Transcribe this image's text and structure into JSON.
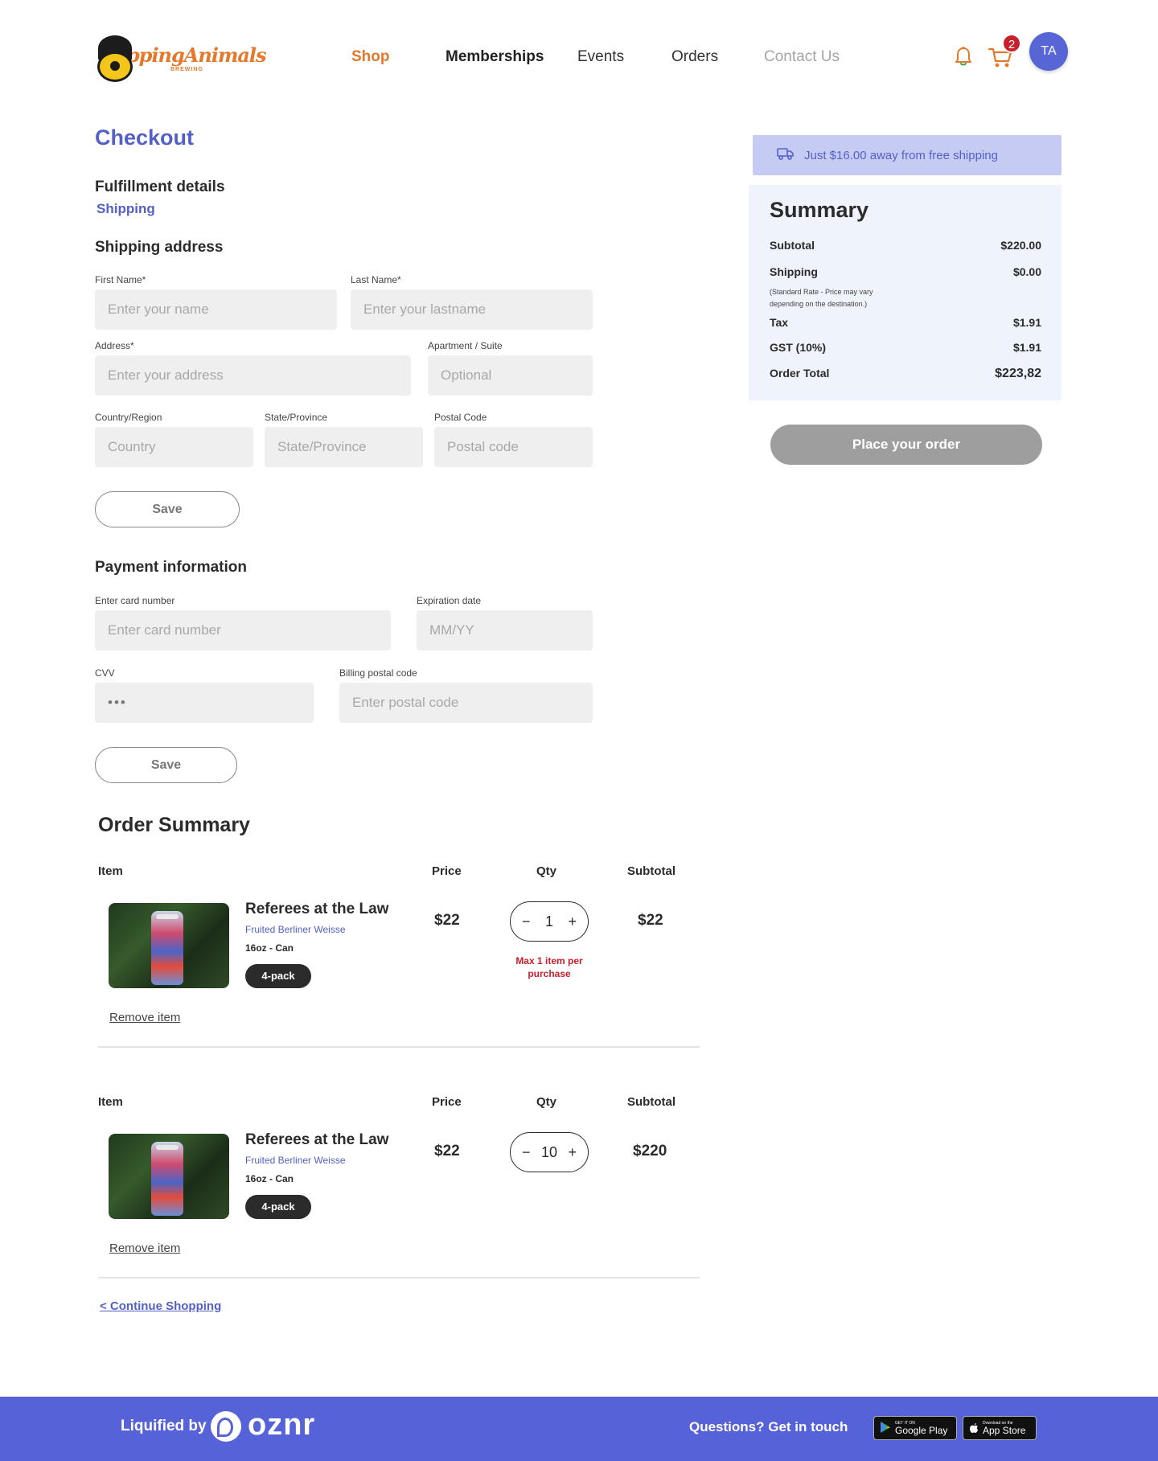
{
  "brand": {
    "logo_text": "TrippingAnimals",
    "logo_sub": "BREWING"
  },
  "nav": {
    "shop": "Shop",
    "memberships": "Memberships",
    "events": "Events",
    "orders": "Orders",
    "contact": "Contact Us"
  },
  "header": {
    "cart_count": "2",
    "avatar_initials": "TA"
  },
  "checkout": {
    "title": "Checkout",
    "fulfillment_heading": "Fulfillment details",
    "fulfillment_method": "Shipping",
    "shipping_heading": "Shipping address",
    "fields": {
      "first_name": {
        "label": "First Name*",
        "placeholder": "Enter your name"
      },
      "last_name": {
        "label": "Last Name*",
        "placeholder": "Enter your lastname"
      },
      "address": {
        "label": "Address*",
        "placeholder": "Enter your address"
      },
      "apartment": {
        "label": "Apartment / Suite",
        "placeholder": "Optional"
      },
      "country": {
        "label": "Country/Region",
        "placeholder": "Country"
      },
      "state": {
        "label": "State/Province",
        "placeholder": "State/Province"
      },
      "postal": {
        "label": "Postal Code",
        "placeholder": "Postal code"
      }
    },
    "save_label": "Save",
    "payment_heading": "Payment information",
    "payment_fields": {
      "card": {
        "label": "Enter card number",
        "placeholder": "Enter card number"
      },
      "expiry": {
        "label": "Expiration date",
        "placeholder": "MM/YY"
      },
      "cvv": {
        "label": "CVV",
        "value": "•••"
      },
      "billing_postal": {
        "label": "Billing postal code",
        "placeholder": "Enter postal code"
      }
    },
    "payment_save_label": "Save"
  },
  "order_summary": {
    "title": "Order Summary",
    "columns": {
      "item": "Item",
      "price": "Price",
      "qty": "Qty",
      "subtotal": "Subtotal"
    },
    "items": [
      {
        "name": "Referees at the Law",
        "style": "Fruited Berliner Weisse",
        "size": "16oz - Can",
        "pack": "4-pack",
        "price": "$22",
        "qty": "1",
        "subtotal": "$22",
        "note": "Max 1 item per purchase",
        "remove": "Remove item"
      },
      {
        "name": "Referees at the Law",
        "style": "Fruited Berliner Weisse",
        "size": "16oz - Can",
        "pack": "4-pack",
        "price": "$22",
        "qty": "10",
        "subtotal": "$220",
        "remove": "Remove item"
      }
    ],
    "qty_minus": "−",
    "qty_plus": "+",
    "continue": "< Continue Shopping"
  },
  "summary": {
    "free_shipping": "Just $16.00 away from free shipping",
    "title": "Summary",
    "subtotal_label": "Subtotal",
    "subtotal_value": "$220.00",
    "shipping_label": "Shipping",
    "shipping_value": "$0.00",
    "shipping_note": "(Standard Rate - Price may vary depending on the destination.)",
    "tax_label": "Tax",
    "tax_value": "$1.91",
    "gst_label": "GST (10%)",
    "gst_value": "$1.91",
    "total_label": "Order Total",
    "total_value": "$223,82",
    "place_order": "Place your order"
  },
  "footer": {
    "liquified_by": "Liquified by",
    "brand": "oznr",
    "questions": "Questions? Get in touch",
    "google_small": "GET IT ON",
    "google_big": "Google Play",
    "apple_small": "Download on the",
    "apple_big": "App Store"
  },
  "colors": {
    "accent": "#5361c7",
    "shop_orange": "#e4792b",
    "footer_bg": "#5663d8",
    "error_red": "#c8202a",
    "summary_bg": "#eef3fc",
    "free_ship_bg": "#c6cbf4"
  },
  "icons": [
    "bell-icon",
    "cart-icon",
    "truck-icon",
    "google-play-icon",
    "apple-icon"
  ]
}
